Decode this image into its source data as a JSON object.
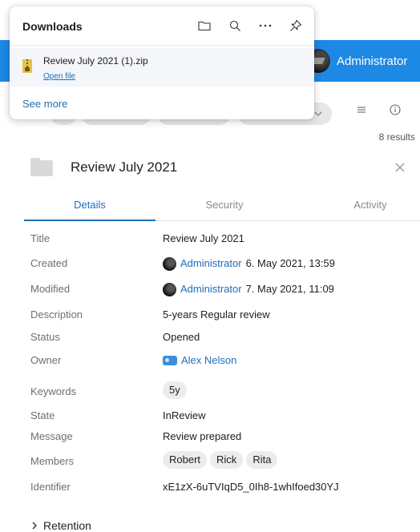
{
  "downloads": {
    "title": "Downloads",
    "item": {
      "filename": "Review July 2021 (1).zip",
      "open_label": "Open file"
    },
    "see_more": "See more"
  },
  "header": {
    "user_name": "Administrator"
  },
  "results_text": "8 results",
  "panel": {
    "title": "Review July 2021",
    "tabs": [
      "Details",
      "Security",
      "Activity"
    ],
    "active_tab": "Details"
  },
  "properties": {
    "title": {
      "label": "Title",
      "value": "Review July 2021"
    },
    "created": {
      "label": "Created",
      "user": "Administrator",
      "date": "6. May 2021, 13:59"
    },
    "modified": {
      "label": "Modified",
      "user": "Administrator",
      "date": "7. May 2021, 11:09"
    },
    "description": {
      "label": "Description",
      "value": "5-years Regular review"
    },
    "status": {
      "label": "Status",
      "value": "Opened"
    },
    "owner": {
      "label": "Owner",
      "value": "Alex Nelson"
    },
    "keywords": {
      "label": "Keywords",
      "values": [
        "5y"
      ]
    },
    "state": {
      "label": "State",
      "value": "InReview"
    },
    "message": {
      "label": "Message",
      "value": "Review prepared"
    },
    "members": {
      "label": "Members",
      "values": [
        "Robert",
        "Rick",
        "Rita"
      ]
    },
    "identifier": {
      "label": "Identifier",
      "value": "xE1zX-6uTVIqD5_0Ih8-1whIfoed30YJ"
    }
  },
  "retention_label": "Retention",
  "icons": {
    "folder": "folder-icon",
    "search": "search-icon",
    "more": "more-icon",
    "pin": "pin-icon",
    "close": "close-icon",
    "info": "info-icon",
    "list": "list-icon",
    "chevron": "chevron-right-icon"
  },
  "colors": {
    "accent": "#1e88e5",
    "link": "#1e6fb8"
  }
}
